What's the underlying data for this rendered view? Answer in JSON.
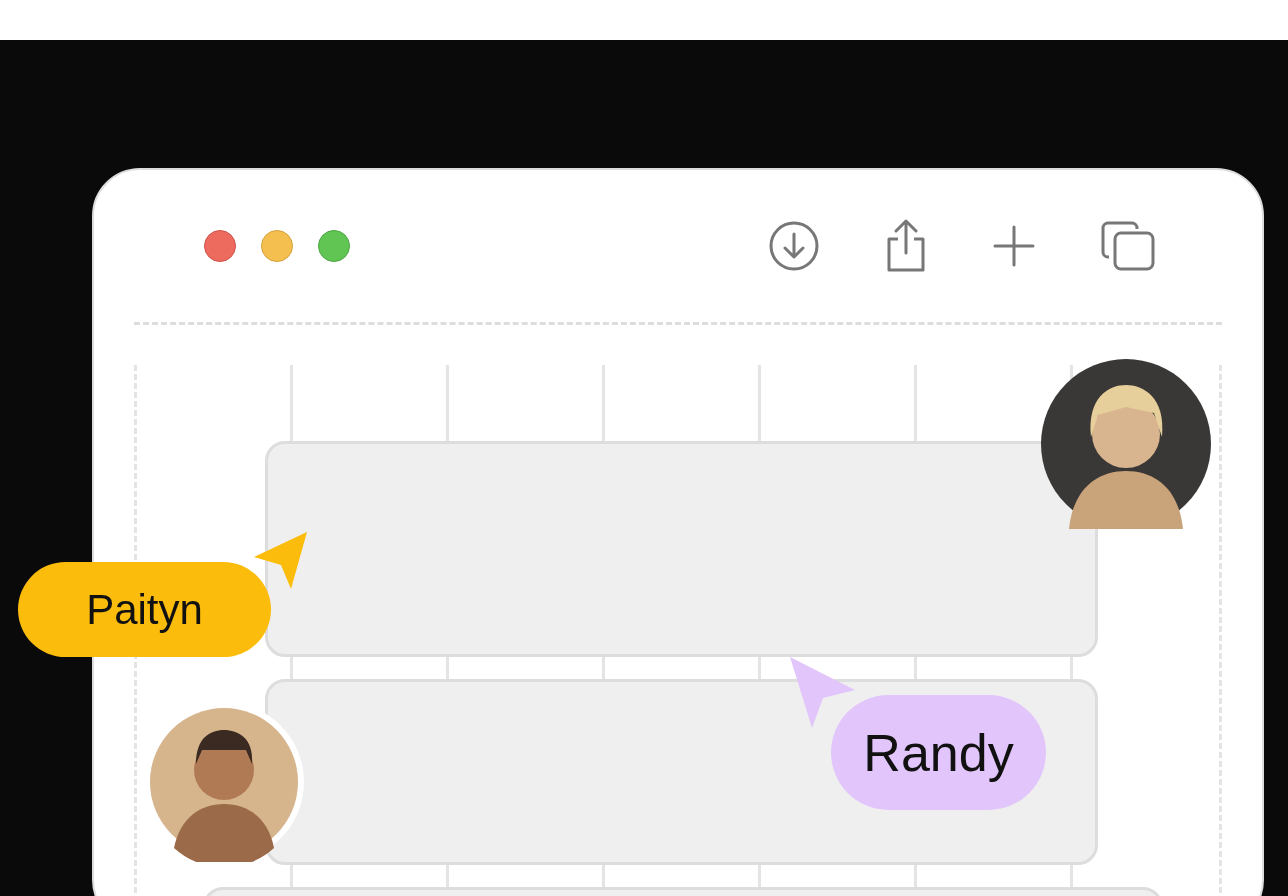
{
  "collaborators": [
    {
      "name": "Paityn",
      "color": "#fbbc0c"
    },
    {
      "name": "Randy",
      "color": "#e2c6fb"
    }
  ]
}
